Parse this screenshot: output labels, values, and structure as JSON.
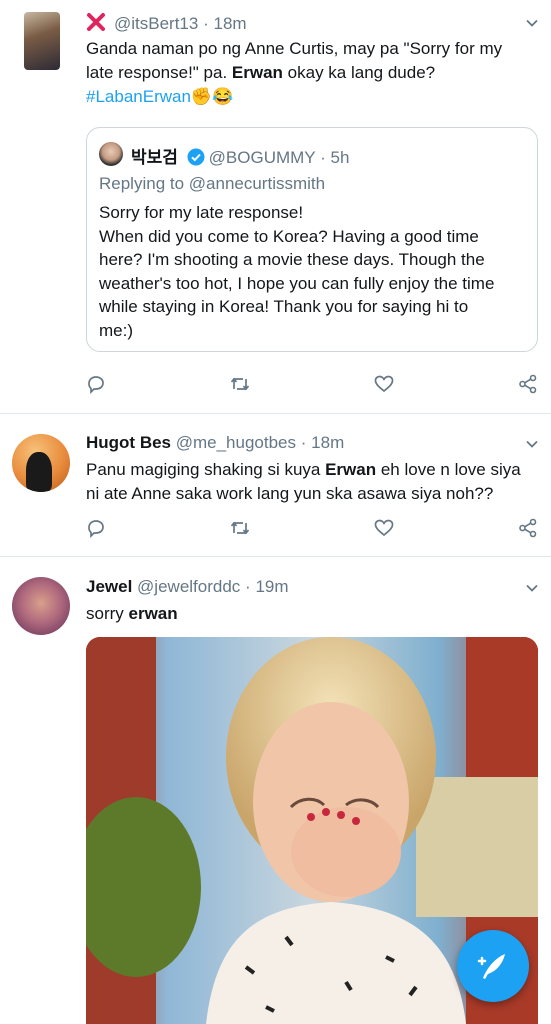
{
  "tweets": [
    {
      "handle": "@itsBert13",
      "time": "18m",
      "text_1": "Ganda naman po ng Anne Curtis, may pa \"Sorry for my",
      "text_2a": "late response!\" pa. ",
      "text_2b": "Erwan",
      "text_2c": " okay ka lang dude?",
      "hashtag": "#LabanErwan",
      "emoji": "✊😂",
      "quote": {
        "name": "박보검",
        "handle": "@BOGUMMY",
        "time": "5h",
        "replying_to": "Replying to @annecurtissmith",
        "lines": [
          "Sorry for my late response!",
          "When did you come to Korea? Having a good time",
          "here? I'm shooting a movie these days. Though the",
          "weather's too hot, I hope you can fully enjoy the time",
          "while staying in Korea! Thank you for saying hi to",
          "me:)"
        ]
      }
    },
    {
      "name": "Hugot Bes",
      "handle": "@me_hugotbes",
      "time": "18m",
      "text_1a": "Panu magiging shaking si kuya ",
      "text_1b": "Erwan",
      "text_1c": " eh love n love siya",
      "text_2": "ni ate Anne saka work lang yun ska asawa siya noh??"
    },
    {
      "name": "Jewel",
      "handle": "@jewelforddc",
      "time": "19m",
      "text_a": "sorry ",
      "text_b": "erwan"
    }
  ],
  "separator": "·",
  "colors": {
    "accent": "#1da1f2",
    "secondary": "#657786",
    "divider": "#e1e8ed",
    "x_mark": "#e0245e"
  }
}
